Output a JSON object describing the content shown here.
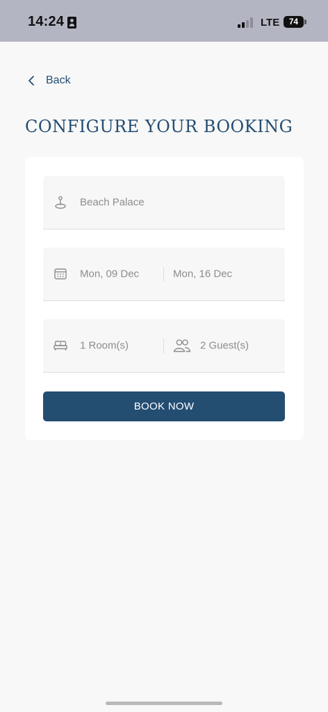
{
  "status_bar": {
    "time": "14:24",
    "network": "LTE",
    "battery": "74"
  },
  "nav": {
    "back_label": "Back"
  },
  "page": {
    "title": "CONFIGURE YOUR BOOKING"
  },
  "booking": {
    "hotel": "Beach Palace",
    "check_in": "Mon, 09 Dec",
    "check_out": "Mon, 16 Dec",
    "rooms": "1 Room(s)",
    "guests": "2 Guest(s)",
    "book_label": "BOOK NOW"
  },
  "icons": {
    "status_id": "person-badge-icon",
    "signal": "cellular-signal-icon",
    "battery": "battery-icon",
    "back": "chevron-left-icon",
    "hotel": "map-pin-icon",
    "dates": "calendar-icon",
    "rooms": "bed-icon",
    "guests": "users-icon"
  },
  "colors": {
    "status_bar": "#b4b5c3",
    "brand": "#244d72",
    "background": "#f8f8f8",
    "card": "#ffffff",
    "field": "#f7f7f7",
    "muted_text": "#8c8c8c"
  }
}
